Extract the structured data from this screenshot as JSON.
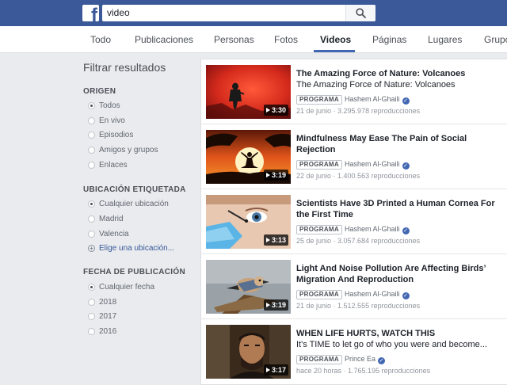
{
  "search": {
    "query": "video"
  },
  "tabs": [
    {
      "label": "Todo"
    },
    {
      "label": "Publicaciones"
    },
    {
      "label": "Personas"
    },
    {
      "label": "Fotos"
    },
    {
      "label": "Videos"
    },
    {
      "label": "Páginas"
    },
    {
      "label": "Lugares"
    },
    {
      "label": "Grupos"
    }
  ],
  "active_tab": "Videos",
  "filters": {
    "title": "Filtrar resultados",
    "origen": {
      "title": "ORIGEN",
      "options": [
        "Todos",
        "En vivo",
        "Episodios",
        "Amigos y grupos",
        "Enlaces"
      ],
      "selected": "Todos"
    },
    "ubicacion": {
      "title": "UBICACIÓN ETIQUETADA",
      "options": [
        "Cualquier ubicación",
        "Madrid",
        "Valencia"
      ],
      "selected": "Cualquier ubicación",
      "link": "Elige una ubicación..."
    },
    "fecha": {
      "title": "FECHA DE PUBLICACIÓN",
      "options": [
        "Cualquier fecha",
        "2018",
        "2017",
        "2016"
      ],
      "selected": "Cualquier fecha"
    }
  },
  "results": [
    {
      "title": "The Amazing Force of Nature: Volcanoes",
      "subtitle": "The Amazing Force of Nature: Volcanoes",
      "duration": "3:30",
      "badge": "PROGRAMA",
      "author": "Hashem Al-Ghaili",
      "stats": "21 de junio · 3.295.978 reproducciones"
    },
    {
      "title": "Mindfulness May Ease The Pain of Social Rejection",
      "subtitle": "",
      "duration": "3:19",
      "badge": "PROGRAMA",
      "author": "Hashem Al-Ghaili",
      "stats": "22 de junio · 1.400.563 reproducciones"
    },
    {
      "title": "Scientists Have 3D Printed a Human Cornea For the First Time",
      "subtitle": "",
      "duration": "3:13",
      "badge": "PROGRAMA",
      "author": "Hashem Al-Ghaili",
      "stats": "25 de junio · 3.057.684 reproducciones"
    },
    {
      "title": "Light And Noise Pollution Are Affecting Birds’ Migration And Reproduction",
      "subtitle": "",
      "duration": "3:19",
      "badge": "PROGRAMA",
      "author": "Hashem Al-Ghaili",
      "stats": "21 de junio · 1.512.555 reproducciones"
    },
    {
      "title": "WHEN LIFE HURTS, WATCH THIS",
      "subtitle": "It's TIME to let go of who you were and become...",
      "duration": "3:17",
      "badge": "PROGRAMA",
      "author": "Prince Ea",
      "stats": "hace 20 horas · 1.765.195 reproducciones"
    }
  ],
  "colors": {
    "brand": "#3b5998",
    "accent": "#4267b2",
    "page_bg": "#e9ebee"
  }
}
